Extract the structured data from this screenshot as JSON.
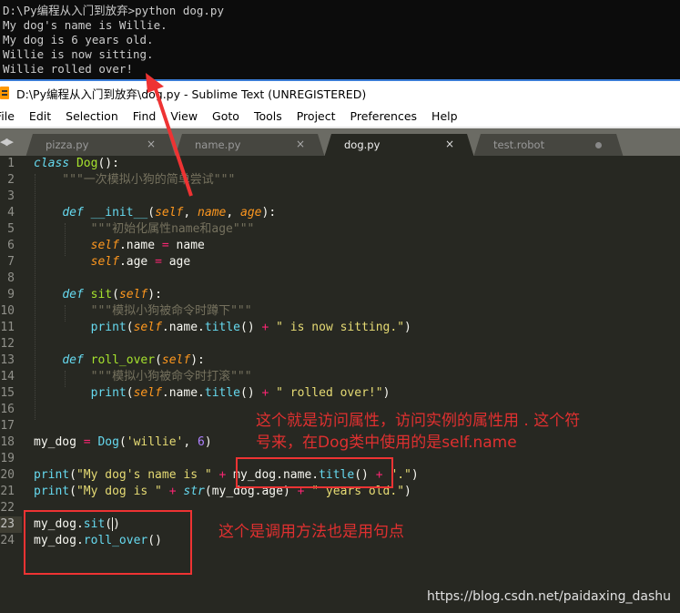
{
  "console": {
    "lines": [
      "D:\\Py编程从入门到放弃>python dog.py",
      "My dog's name is Willie.",
      "My dog is 6 years old.",
      "Willie is now sitting.",
      "Willie rolled over!"
    ]
  },
  "window": {
    "title": "D:\\Py编程从入门到放弃\\dog.py - Sublime Text (UNREGISTERED)"
  },
  "menu": {
    "items": [
      "File",
      "Edit",
      "Selection",
      "Find",
      "View",
      "Goto",
      "Tools",
      "Project",
      "Preferences",
      "Help"
    ]
  },
  "tabs": [
    {
      "label": "pizza.py",
      "state": "close"
    },
    {
      "label": "name.py",
      "state": "close"
    },
    {
      "label": "dog.py",
      "state": "active"
    },
    {
      "label": "test.robot",
      "state": "modified"
    }
  ],
  "tab_close_glyph": "×",
  "tab_nav_glyph": "◀▶",
  "editor": {
    "line_numbers": [
      "1",
      "2",
      "3",
      "4",
      "5",
      "6",
      "7",
      "8",
      "9",
      "10",
      "11",
      "12",
      "13",
      "14",
      "15",
      "16",
      "17",
      "18",
      "19",
      "20",
      "21",
      "22",
      "23",
      "24"
    ],
    "current_line": 23,
    "code": {
      "l1": [
        "class",
        "Dog",
        "():"
      ],
      "l2": "    \"\"\"一次模拟小狗的简单尝试\"\"\"",
      "l4": [
        "def",
        "__init__",
        "self",
        "name",
        "age"
      ],
      "l5": "        \"\"\"初始化属性name和age\"\"\"",
      "l6": [
        "self",
        ".name ",
        "=",
        " name"
      ],
      "l7": [
        "self",
        ".age ",
        "=",
        " age"
      ],
      "l9": [
        "def",
        "sit",
        "self"
      ],
      "l10": "        \"\"\"模拟小狗被命令时蹲下\"\"\"",
      "l11": [
        "print",
        "self",
        "title",
        "\" is now sitting.\""
      ],
      "l13": [
        "def",
        "roll_over",
        "self"
      ],
      "l14": "        \"\"\"模拟小狗被命令时打滚\"\"\"",
      "l15": [
        "print",
        "self",
        "title",
        "\" rolled over!\""
      ],
      "l18": [
        "my_dog ",
        "=",
        "Dog",
        "'willie'",
        "6"
      ],
      "l20": [
        "print",
        "\"My dog's name is \"",
        "my_dog.name.",
        "title",
        "\".\""
      ],
      "l21": [
        "print",
        "\"My dog is \"",
        "str",
        "my_dog.age",
        "\" years old.\""
      ],
      "l23": [
        "my_dog.",
        "sit"
      ],
      "l24": [
        "my_dog.",
        "roll_over"
      ]
    }
  },
  "annotations": {
    "attribute_note_line1": "这个就是访问属性，访问实例的属性用  . 这个符",
    "attribute_note_line2": "号来，在Dog类中使用的是self.name",
    "method_note": "这个是调用方法也是用句点"
  },
  "watermark": "https://blog.csdn.net/paidaxing_dashu",
  "colors": {
    "annotation_red": "#ee3333",
    "editor_bg": "#272822",
    "console_bg": "#0c0c0c"
  }
}
